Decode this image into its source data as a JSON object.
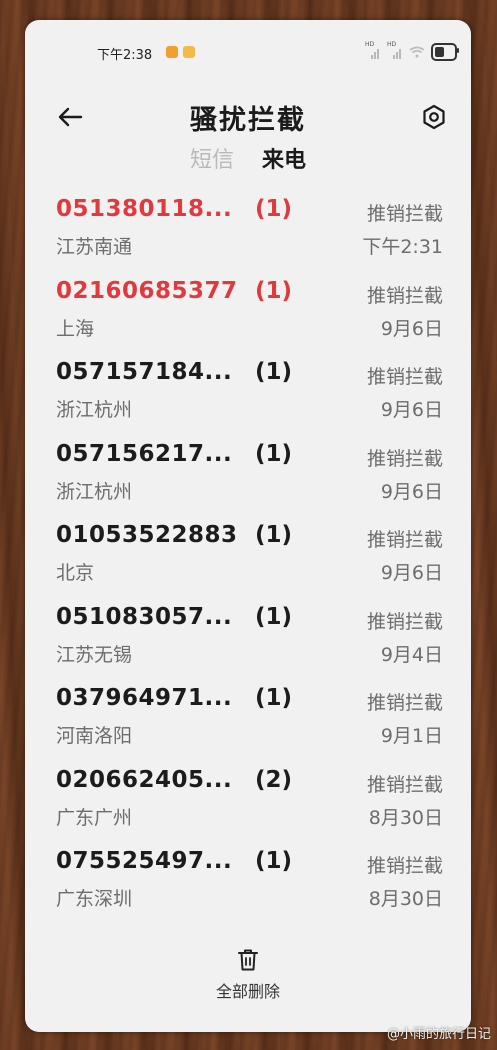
{
  "status_bar": {
    "time": "下午2:38",
    "network_badge_1": "HD",
    "network_badge_2": "HD"
  },
  "header": {
    "title": "骚扰拦截",
    "back_icon": "arrow-left-icon",
    "settings_icon": "settings-icon"
  },
  "tabs": [
    {
      "label": "短信",
      "active": false
    },
    {
      "label": "来电",
      "active": true
    }
  ],
  "calls": [
    {
      "number": "051380118...",
      "count": "(1)",
      "location": "江苏南通",
      "type": "推销拦截",
      "date": "下午2:31",
      "color": "#e0393e"
    },
    {
      "number": "02160685377",
      "count": "(1)",
      "location": "上海",
      "type": "推销拦截",
      "date": "9月6日",
      "color": "#e0393e"
    },
    {
      "number": "057157184...",
      "count": "(1)",
      "location": "浙江杭州",
      "type": "推销拦截",
      "date": "9月6日",
      "color": "#1c1c1c"
    },
    {
      "number": "057156217...",
      "count": "(1)",
      "location": "浙江杭州",
      "type": "推销拦截",
      "date": "9月6日",
      "color": "#1c1c1c"
    },
    {
      "number": "01053522883",
      "count": "(1)",
      "location": "北京",
      "type": "推销拦截",
      "date": "9月6日",
      "color": "#1c1c1c"
    },
    {
      "number": "051083057...",
      "count": "(1)",
      "location": "江苏无锡",
      "type": "推销拦截",
      "date": "9月4日",
      "color": "#1c1c1c"
    },
    {
      "number": "037964971...",
      "count": "(1)",
      "location": "河南洛阳",
      "type": "推销拦截",
      "date": "9月1日",
      "color": "#1c1c1c"
    },
    {
      "number": "020662405...",
      "count": "(2)",
      "location": "广东广州",
      "type": "推销拦截",
      "date": "8月30日",
      "color": "#1c1c1c"
    },
    {
      "number": "075525497...",
      "count": "(1)",
      "location": "广东深圳",
      "type": "推销拦截",
      "date": "8月30日",
      "color": "#1c1c1c"
    }
  ],
  "footer": {
    "delete_all_label": "全部删除",
    "delete_icon": "trash-icon"
  },
  "watermark": "@小雨的旅行日记"
}
